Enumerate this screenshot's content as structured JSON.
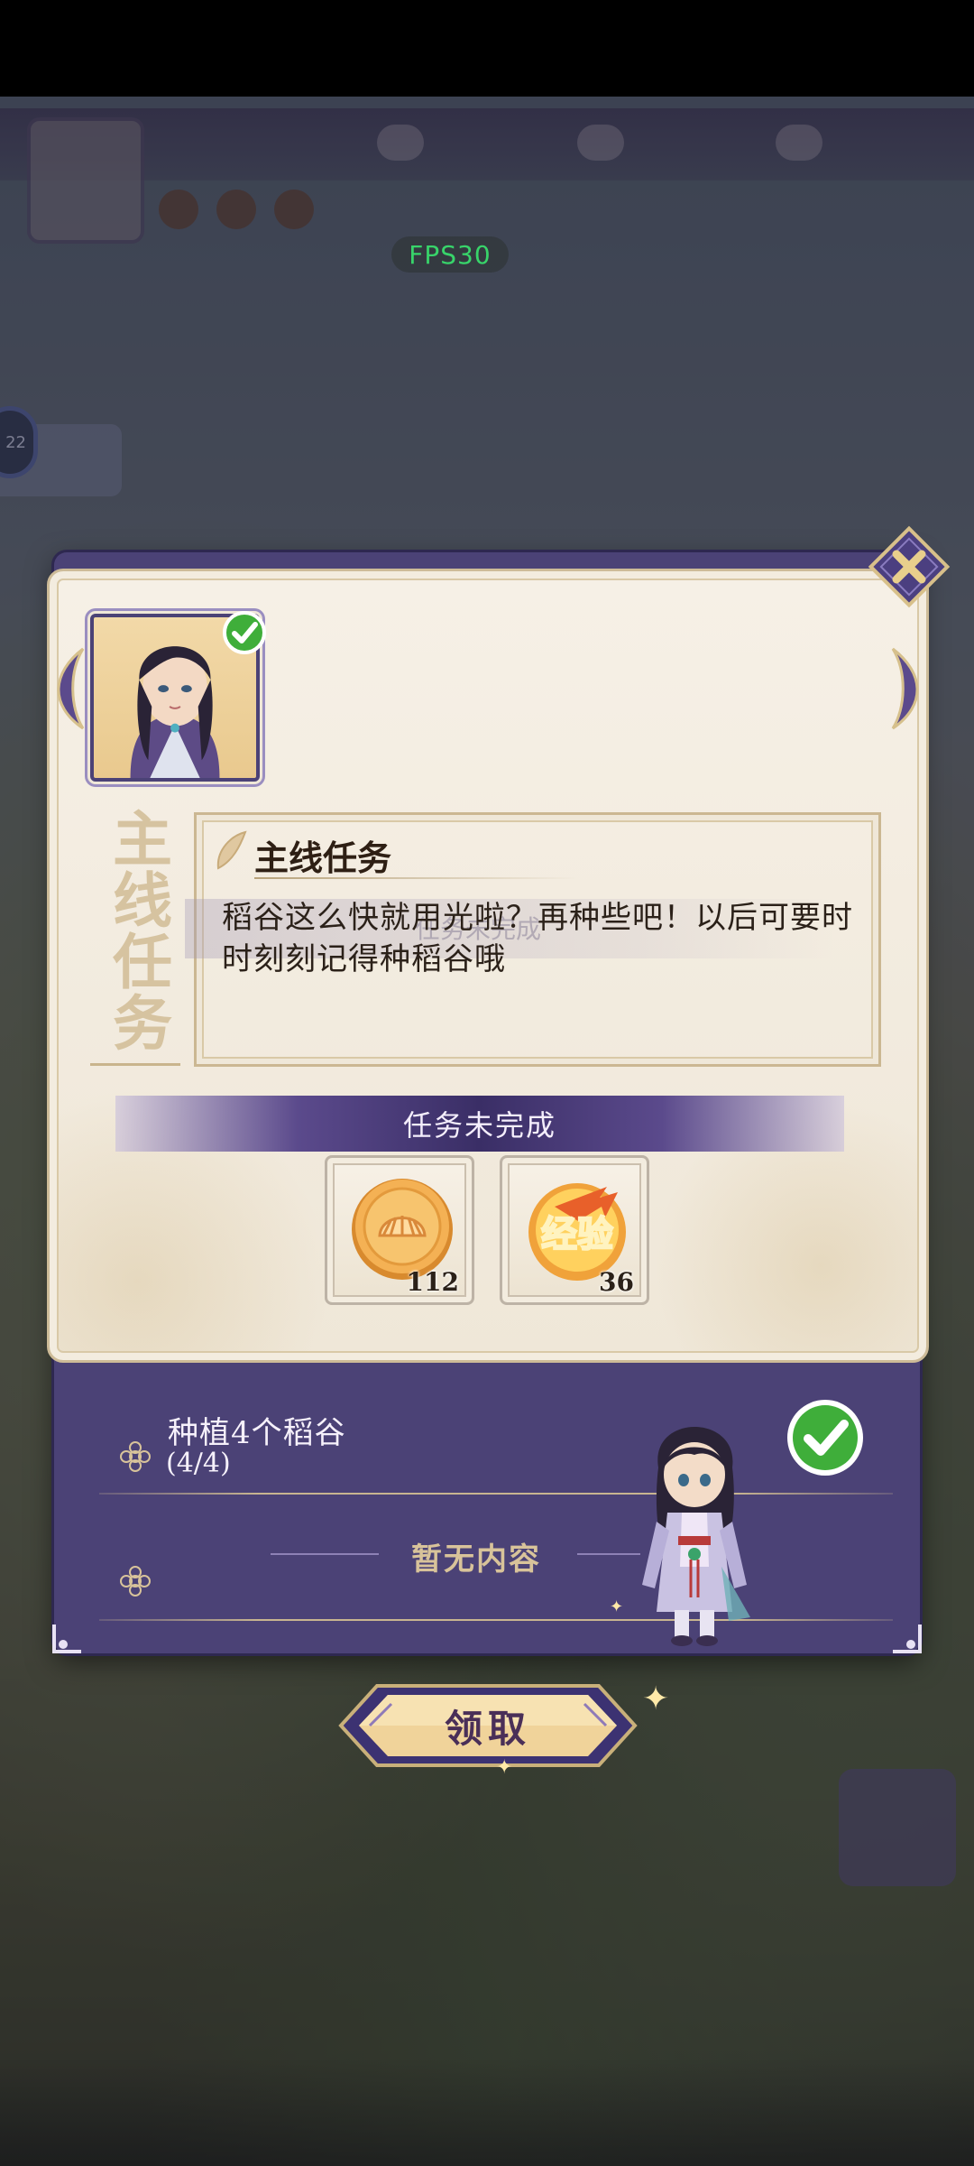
{
  "hud": {
    "fps_label": "FPS30",
    "left_chip_text": "22"
  },
  "quest": {
    "vertical_title": "主线任务",
    "heading": "主线任务",
    "description": "稻谷这么快就用光啦？再种些吧！以后可要时时刻刻记得种稻谷哦",
    "ghost_text": "任务未完成",
    "status": "任务未完成"
  },
  "rewards": [
    {
      "name": "gold-coin",
      "icon": "shell-coin-icon",
      "count": "112"
    },
    {
      "name": "experience",
      "icon": "experience-icon",
      "icon_text": "经验",
      "count": "36"
    }
  ],
  "objective": {
    "text": "种植4个稻谷",
    "progress": "(4/4)",
    "empty_text": "暂无内容"
  },
  "claim_button": {
    "label": "领取"
  },
  "colors": {
    "panel_purple": "#4b4276",
    "parchment": "#f6f0e6",
    "status_band": "#3a2e66",
    "check_green": "#3fae3a",
    "gold": "#e6b45c"
  }
}
